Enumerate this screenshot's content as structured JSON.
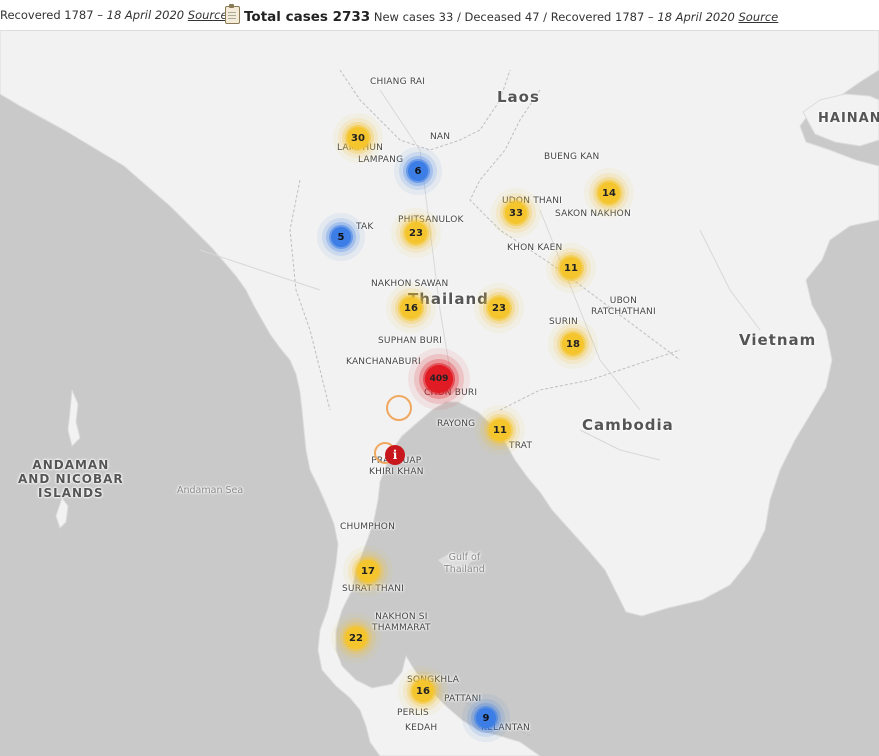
{
  "ticker": {
    "segments": [
      {
        "lead": "Recovered 1787",
        "date": "18 April 2020",
        "source": "Source"
      },
      {
        "total_label": "Total cases 2733",
        "detail": "New cases 33 / Deceased 47 / Recovered 1787",
        "date": "18 April 2020",
        "source": "Source"
      }
    ]
  },
  "countries": [
    "Laos",
    "Thailand",
    "Vietnam",
    "Cambodia",
    "HAINAN",
    "ANDAMAN\nAND NICOBAR\nISLANDS"
  ],
  "seas": [
    "Andaman Sea",
    "Gulf of\nThailand"
  ],
  "cities": [
    "CHIANG RAI",
    "NAN",
    "LAMPHUN",
    "LAMPANG",
    "BUENG KAN",
    "UDON THANI",
    "SAKON NAKHON",
    "PHITSANULOK",
    "TAK",
    "KHON KAEN",
    "NAKHON SAWAN",
    "UBON\nRATCHATHANI",
    "SURIN",
    "SUPHAN BURI",
    "KANCHANABURI",
    "CHON BURI",
    "RAYONG",
    "TRAT",
    "PRACHUAP\nKHIRI KHAN",
    "CHUMPHON",
    "SURAT THANI",
    "NAKHON SI\nTHAMMARAT",
    "SONGKHLA",
    "PATTANI",
    "PERLIS",
    "KEDAH",
    "KELANTAN"
  ],
  "markers": [
    {
      "count": "30",
      "color": "yellow"
    },
    {
      "count": "6",
      "color": "blue"
    },
    {
      "count": "5",
      "color": "blue"
    },
    {
      "count": "23",
      "color": "yellow"
    },
    {
      "count": "33",
      "color": "yellow"
    },
    {
      "count": "14",
      "color": "yellow"
    },
    {
      "count": "11",
      "color": "yellow"
    },
    {
      "count": "16",
      "color": "yellow"
    },
    {
      "count": "23",
      "color": "yellow"
    },
    {
      "count": "18",
      "color": "yellow"
    },
    {
      "count": "409",
      "color": "red"
    },
    {
      "count": "11",
      "color": "yellow"
    },
    {
      "count": "i",
      "color": "red-info"
    },
    {
      "count": "17",
      "color": "yellow"
    },
    {
      "count": "22",
      "color": "yellow"
    },
    {
      "count": "16",
      "color": "yellow"
    },
    {
      "count": "9",
      "color": "blue"
    }
  ],
  "colors": {
    "yellow": "#f5c52e",
    "blue": "#3c7de6",
    "red": "#e01b24",
    "land": "#f2f2f2",
    "sea": "#c9c9c9"
  },
  "icons": {
    "clipboard": "clipboard-icon"
  }
}
